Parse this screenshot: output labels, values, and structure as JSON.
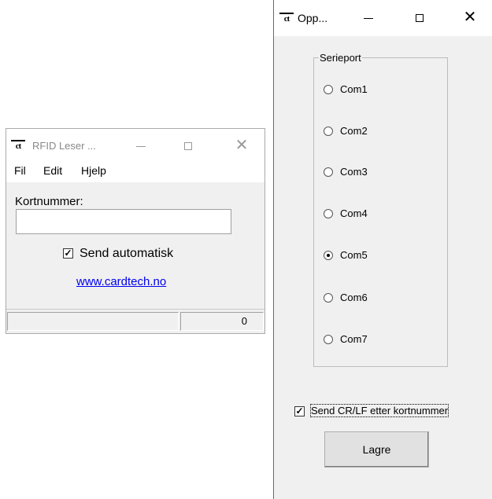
{
  "reader_window": {
    "title": "RFID Leser ...",
    "menu": [
      "Fil",
      "Edit",
      "Hjelp"
    ],
    "card_number_label": "Kortnummer:",
    "card_number_value": "",
    "auto_send_label": "Send automatisk",
    "auto_send_checked": true,
    "link_text": "www.cardtech.no",
    "status_left": "",
    "status_count": "0"
  },
  "settings_window": {
    "title": "Opp...",
    "group_label": "Serieport",
    "ports": [
      "Com1",
      "Com2",
      "Com3",
      "Com4",
      "Com5",
      "Com6",
      "Com7"
    ],
    "selected_port": "Com5",
    "crlf_label": "Send CR/LF etter kortnummer",
    "crlf_checked": true,
    "save_label": "Lagre"
  },
  "icons": {
    "app_icon": "ct-logo-icon",
    "minimize": "minimize-icon",
    "maximize": "maximize-icon",
    "close": "close-icon"
  },
  "colors": {
    "window_bg": "#f0f0f0",
    "titlebar_bg": "#ffffff",
    "link": "#0000ee",
    "active_border": "#1e7ad7"
  }
}
